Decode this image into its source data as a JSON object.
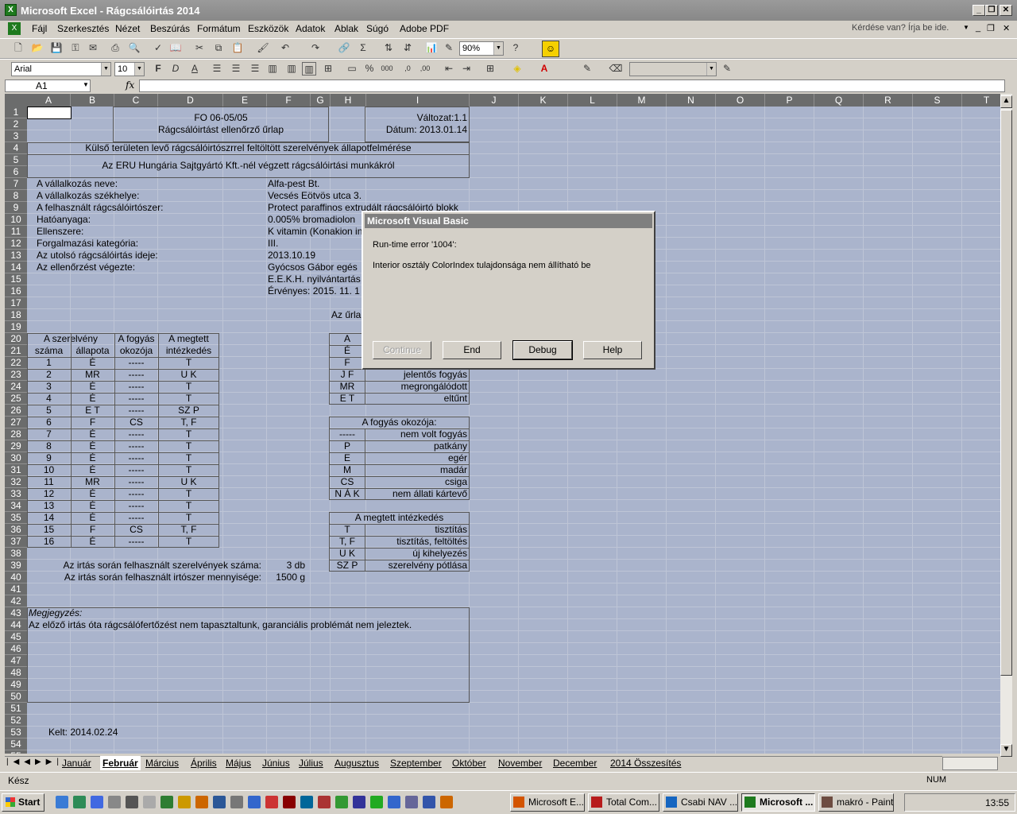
{
  "window": {
    "title": "Microsoft Excel - Rágcsálóirtás 2014"
  },
  "menu": [
    "Fájl",
    "Szerkesztés",
    "Nézet",
    "Beszúrás",
    "Formátum",
    "Eszközök",
    "Adatok",
    "Ablak",
    "Súgó",
    "Adobe PDF"
  ],
  "help_box": "Kérdése van? Írja be ide.",
  "toolbar": {
    "zoom": "90%",
    "font": "Arial",
    "font_size": "10"
  },
  "formula_bar": {
    "name_box": "A1",
    "fx": "fx"
  },
  "columns": [
    "A",
    "B",
    "C",
    "D",
    "E",
    "F",
    "G",
    "H",
    "I",
    "J",
    "K",
    "L",
    "M",
    "N",
    "O",
    "P",
    "Q",
    "R",
    "S",
    "T"
  ],
  "rows": [
    "1",
    "2",
    "3",
    "4",
    "5",
    "6",
    "7",
    "8",
    "9",
    "10",
    "11",
    "12",
    "13",
    "14",
    "15",
    "16",
    "17",
    "18",
    "19",
    "20",
    "21",
    "22",
    "23",
    "24",
    "25",
    "26",
    "27",
    "28",
    "29",
    "30",
    "31",
    "32",
    "33",
    "34",
    "35",
    "36",
    "37",
    "38",
    "39",
    "40",
    "41",
    "42",
    "43",
    "44",
    "45",
    "46",
    "47",
    "48",
    "49",
    "50",
    "51",
    "52",
    "53",
    "54",
    "55"
  ],
  "sheet": {
    "header_code": "FO 06-05/05",
    "header_title": "Rágcsálóirtást ellenőrző űrlap",
    "version": "Változat:1.1",
    "date": "Dátum: 2013.01.14",
    "line4": "Külső területen levő rágcsálóirtószrrel feltöltött szerelvények állapotfelmérése",
    "line5": "Az ERU Hungária Sajtgyártó Kft.-nél  végzett rágcsálóirtási munkákról",
    "info_labels": [
      "A vállalkozás neve:",
      "A vállalkozás székhelye:",
      "A felhasznált rágcsálóirtószer:",
      "Hatóanyaga:",
      "Ellenszere:",
      "Forgalmazási kategória:",
      "Az utolsó rágcsálóirtás ideje:",
      "Az ellenőrzést végezte:"
    ],
    "info_values": [
      "Alfa-pest Bt.",
      "Vecsés Eötvös utca 3.",
      "Protect paraffinos extrudált rágcsálóirtó blokk",
      "0.005% bromadiolon",
      "K vitamin (Konakion in",
      "III.",
      "2013.10.19",
      "Gyócsos Gábor egés",
      "E.E.K.H. nyilvántartás",
      "Érvényes: 2015. 11. 1"
    ],
    "urlap": "Az űrlap",
    "table_head": [
      "A szerelvény",
      "A fogyás",
      "A megtett",
      "száma",
      "állapota",
      "okozója",
      "intézkedés"
    ],
    "table_rows": [
      [
        "1",
        "É",
        "-----",
        "T"
      ],
      [
        "2",
        "MR",
        "-----",
        "U K"
      ],
      [
        "3",
        "É",
        "-----",
        "T"
      ],
      [
        "4",
        "É",
        "-----",
        "T"
      ],
      [
        "5",
        "E T",
        "-----",
        "SZ P"
      ],
      [
        "6",
        "F",
        "CS",
        "T, F"
      ],
      [
        "7",
        "É",
        "-----",
        "T"
      ],
      [
        "8",
        "É",
        "-----",
        "T"
      ],
      [
        "9",
        "É",
        "-----",
        "T"
      ],
      [
        "10",
        "É",
        "-----",
        "T"
      ],
      [
        "11",
        "MR",
        "-----",
        "U K"
      ],
      [
        "12",
        "É",
        "-----",
        "T"
      ],
      [
        "13",
        "É",
        "-----",
        "T"
      ],
      [
        "14",
        "É",
        "-----",
        "T"
      ],
      [
        "15",
        "F",
        "CS",
        "T, F"
      ],
      [
        "16",
        "É",
        "-----",
        "T"
      ]
    ],
    "legend1_partial": [
      [
        "A",
        ""
      ],
      [
        "É",
        ""
      ],
      [
        "F",
        ""
      ],
      [
        "J F",
        "jelentős fogyás"
      ],
      [
        "MR",
        "megrongálódott"
      ],
      [
        "E T",
        "eltűnt"
      ]
    ],
    "legend2_title": "A fogyás okozója:",
    "legend2": [
      [
        "-----",
        "nem volt fogyás"
      ],
      [
        "P",
        "patkány"
      ],
      [
        "E",
        "egér"
      ],
      [
        "M",
        "madár"
      ],
      [
        "CS",
        "csiga"
      ],
      [
        "N Á K",
        "nem állati kártevő"
      ]
    ],
    "legend3_title": "A megtett intézkedés",
    "legend3": [
      [
        "T",
        "tisztítás"
      ],
      [
        "T, F",
        "tisztítás, feltöltés"
      ],
      [
        "U K",
        "új kihelyezés"
      ],
      [
        "SZ P",
        "szerelvény pótlása"
      ]
    ],
    "sum1_label": "Az irtás során felhasznált szerelvények száma:",
    "sum1_value": "3 db",
    "sum2_label": "Az irtás során felhasznált irtószer mennyisége:",
    "sum2_value": "1500 g",
    "note_title": "Megjegyzés:",
    "note_text": "Az előző irtás óta rágcsálófertőzést nem tapasztaltunk, garanciális problémát nem jeleztek.",
    "kelt": "Kelt:  2014.02.24"
  },
  "sheet_tabs": [
    "Január",
    "Február",
    "Március",
    "Április",
    "Május",
    "Június",
    "Július",
    "Augusztus",
    "Szeptember",
    "Október",
    "November",
    "December",
    "2014 Összesítés"
  ],
  "active_tab": "Február",
  "status": {
    "left": "Kész",
    "num": "NUM"
  },
  "dialog": {
    "title": "Microsoft Visual Basic",
    "line1": "Run-time error '1004':",
    "line2": "Interior osztály ColorIndex tulajdonsága nem állítható be",
    "buttons": [
      "Continue",
      "End",
      "Debug",
      "Help"
    ]
  },
  "taskbar": {
    "start": "Start",
    "tasks": [
      "Microsoft E...",
      "Total Com...",
      "Csabi NAV ...",
      "Microsoft ...",
      "makró - Paint"
    ],
    "clock": "13:55"
  }
}
